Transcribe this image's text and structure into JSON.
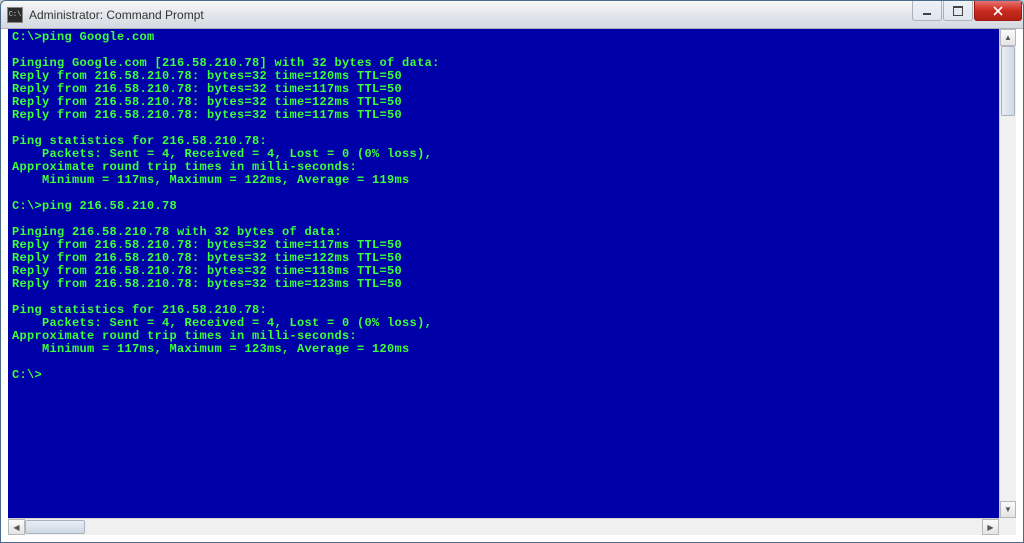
{
  "window": {
    "title": "Administrator: Command Prompt",
    "icon_glyph": "C:\\"
  },
  "terminal": {
    "lines": [
      "C:\\>ping Google.com",
      "",
      "Pinging Google.com [216.58.210.78] with 32 bytes of data:",
      "Reply from 216.58.210.78: bytes=32 time=120ms TTL=50",
      "Reply from 216.58.210.78: bytes=32 time=117ms TTL=50",
      "Reply from 216.58.210.78: bytes=32 time=122ms TTL=50",
      "Reply from 216.58.210.78: bytes=32 time=117ms TTL=50",
      "",
      "Ping statistics for 216.58.210.78:",
      "    Packets: Sent = 4, Received = 4, Lost = 0 (0% loss),",
      "Approximate round trip times in milli-seconds:",
      "    Minimum = 117ms, Maximum = 122ms, Average = 119ms",
      "",
      "C:\\>ping 216.58.210.78",
      "",
      "Pinging 216.58.210.78 with 32 bytes of data:",
      "Reply from 216.58.210.78: bytes=32 time=117ms TTL=50",
      "Reply from 216.58.210.78: bytes=32 time=122ms TTL=50",
      "Reply from 216.58.210.78: bytes=32 time=118ms TTL=50",
      "Reply from 216.58.210.78: bytes=32 time=123ms TTL=50",
      "",
      "Ping statistics for 216.58.210.78:",
      "    Packets: Sent = 4, Received = 4, Lost = 0 (0% loss),",
      "Approximate round trip times in milli-seconds:",
      "    Minimum = 117ms, Maximum = 123ms, Average = 120ms",
      "",
      "C:\\>"
    ]
  },
  "scroll": {
    "up": "▲",
    "down": "▼",
    "left": "◀",
    "right": "▶"
  }
}
